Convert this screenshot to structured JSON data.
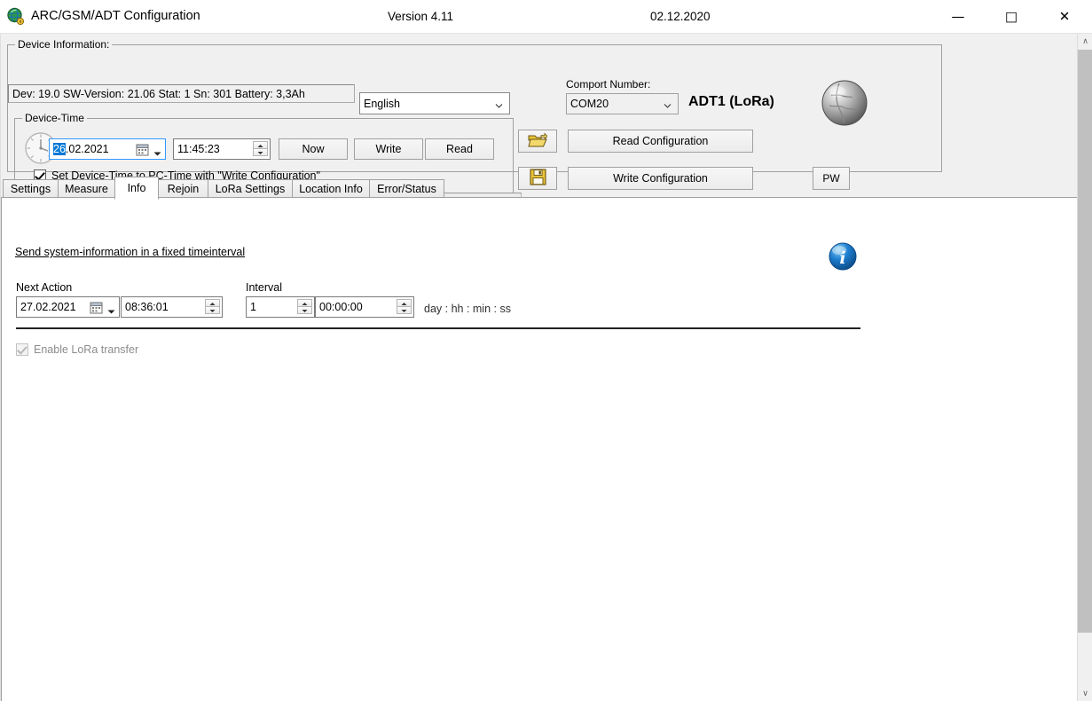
{
  "window": {
    "title": "ARC/GSM/ADT Configuration",
    "version": "Version 4.11",
    "date": "02.12.2020",
    "icon": "globe-key-icon",
    "minimize": "—",
    "maximize": "□",
    "close": "✕"
  },
  "device_information": {
    "group_label": "Device Information:",
    "value": "Dev: 19.0 SW-Version: 21.06 Stat: 1 Sn: 301 Battery: 3,3Ah",
    "language": "English"
  },
  "comport": {
    "label": "Comport Number:",
    "value": "COM20",
    "device_name": "ADT1 (LoRa)",
    "globe_icon": "globe-icon"
  },
  "device_time": {
    "group_label": "Device-Time",
    "clock_icon": "clock-icon",
    "date_selected_part": "26",
    "date_rest": ".02.2021",
    "time": "11:45:23",
    "now_label": "Now",
    "write_label": "Write",
    "read_label": "Read",
    "set_time_checkbox": "Set Device-Time to PC-Time with \"Write Configuration\"",
    "set_time_checked": true
  },
  "actions": {
    "open_icon": "open-folder-icon",
    "save_icon": "floppy-disk-icon",
    "read_configuration": "Read Configuration",
    "write_configuration": "Write Configuration",
    "pw_label": "PW"
  },
  "tabs": [
    {
      "label": "Settings",
      "active": false
    },
    {
      "label": "Measure",
      "active": false
    },
    {
      "label": "Info",
      "active": true
    },
    {
      "label": "Rejoin",
      "active": false
    },
    {
      "label": "LoRa Settings",
      "active": false
    },
    {
      "label": "Location Info",
      "active": false
    },
    {
      "label": "Error/Status",
      "active": false
    }
  ],
  "info_tab": {
    "heading": "Send system-information in a fixed timeinterval",
    "info_icon": "info-icon",
    "next_action_label": "Next Action",
    "next_action_date": "27.02.2021",
    "next_action_time": "08:36:01",
    "interval_label": "Interval",
    "interval_days": "1",
    "interval_time": "00:00:00",
    "interval_format": "day : hh : min : ss",
    "enable_lora_label": "Enable LoRa transfer",
    "enable_lora_checked": true,
    "enable_lora_disabled": true
  },
  "scrollbar": {
    "up_glyph": "∧",
    "down_glyph": "∨"
  },
  "colors": {
    "selection": "#0078d7",
    "window_bg": "#f0f0f0",
    "page_bg": "#ffffff",
    "border": "#a0a0a0"
  }
}
